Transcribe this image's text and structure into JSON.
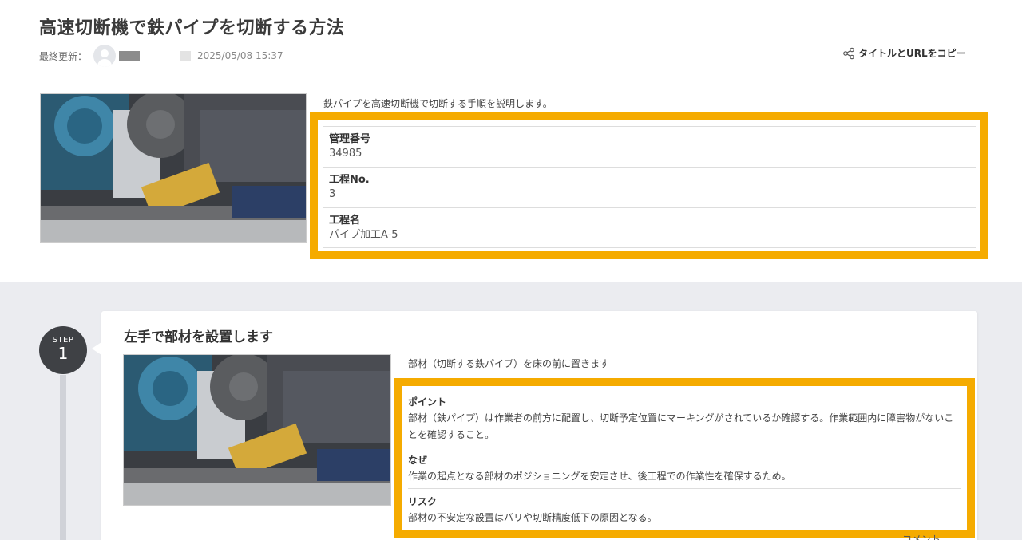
{
  "page": {
    "title": "高速切断機で鉄パイプを切断する方法",
    "updated_label": "最終更新：",
    "updated_date": "2025/05/08 15:37",
    "copy_label": "タイトルとURLをコピー",
    "description": "鉄パイプを高速切断機で切断する手順を説明します。"
  },
  "info": [
    {
      "label": "管理番号",
      "value": "34985"
    },
    {
      "label": "工程No.",
      "value": "3"
    },
    {
      "label": "工程名",
      "value": "パイプ加工A-5"
    }
  ],
  "step": {
    "badge_label": "STEP",
    "number": "1",
    "title": "左手で部材を設置します",
    "description": "部材（切断する鉄パイプ）を床の前に置きます",
    "points": [
      {
        "label": "ポイント",
        "text": "部材（鉄パイプ）は作業者の前方に配置し、切断予定位置にマーキングがされているか確認する。作業範囲内に障害物がないことを確認すること。"
      },
      {
        "label": "なぜ",
        "text": "作業の起点となる部材のポジショニングを安定させ、後工程での作業性を確保するため。"
      },
      {
        "label": "リスク",
        "text": "部材の不安定な設置はバリや切断精度低下の原因となる。"
      }
    ]
  },
  "comment_label": "コメント",
  "colors": {
    "highlight": "#f5ab00",
    "badge": "#3f4145",
    "section_bg": "#ebecf0"
  },
  "icons": {
    "share": "share-icon",
    "avatar": "user-avatar-icon"
  }
}
